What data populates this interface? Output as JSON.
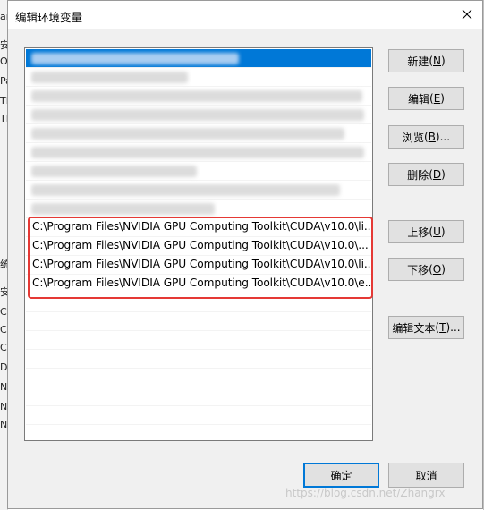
{
  "dialog": {
    "title": "编辑环境变量",
    "close_icon": "close-icon"
  },
  "background_window": {
    "left_fragments": [
      "ar",
      "安",
      "O",
      "Pa",
      "TE",
      "TN",
      "统",
      "安",
      "Co",
      "CU",
      "CU",
      "Dr",
      "N",
      "N",
      "N"
    ]
  },
  "path_list": {
    "selected_index": 0,
    "blurred_rows": 9,
    "highlighted_rows": [
      "C:\\Program Files\\NVIDIA GPU Computing Toolkit\\CUDA\\v10.0\\li...",
      "C:\\Program Files\\NVIDIA GPU Computing Toolkit\\CUDA\\v10.0\\...",
      "C:\\Program Files\\NVIDIA GPU Computing Toolkit\\CUDA\\v10.0\\li...",
      "C:\\Program Files\\NVIDIA GPU Computing Toolkit\\CUDA\\v10.0\\e..."
    ],
    "highlight_color": "#e53935",
    "selection_color": "#0078d7"
  },
  "buttons": {
    "new": {
      "label": "新建",
      "key": "N"
    },
    "edit": {
      "label": "编辑",
      "key": "E"
    },
    "browse": {
      "label": "浏览",
      "key": "B",
      "suffix": "..."
    },
    "delete": {
      "label": "删除",
      "key": "D"
    },
    "move_up": {
      "label": "上移",
      "key": "U"
    },
    "move_down": {
      "label": "下移",
      "key": "O"
    },
    "edit_text": {
      "label": "编辑文本",
      "key": "T",
      "suffix": "..."
    },
    "ok": "确定",
    "cancel": "取消"
  },
  "watermark": "https://blog.csdn.net/Zhangrx"
}
